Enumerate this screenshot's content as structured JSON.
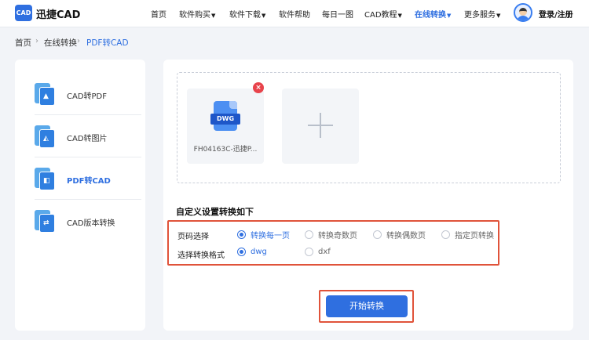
{
  "header": {
    "logo_text": "CAD",
    "brand": "迅捷CAD",
    "nav": [
      {
        "label": "首页",
        "dropdown": false,
        "active": false
      },
      {
        "label": "软件购买",
        "dropdown": true,
        "active": false
      },
      {
        "label": "软件下载",
        "dropdown": true,
        "active": false
      },
      {
        "label": "软件帮助",
        "dropdown": false,
        "active": false
      },
      {
        "label": "每日一图",
        "dropdown": false,
        "active": false
      },
      {
        "label": "CAD教程",
        "dropdown": true,
        "active": false
      },
      {
        "label": "在线转换",
        "dropdown": true,
        "active": true
      },
      {
        "label": "更多服务",
        "dropdown": true,
        "active": false
      }
    ],
    "login": "登录/注册"
  },
  "breadcrumb": [
    "首页",
    "在线转换",
    "PDF转CAD"
  ],
  "sidebar": {
    "items": [
      {
        "label": "CAD转PDF",
        "icon": "cad-to-pdf-icon",
        "active": false
      },
      {
        "label": "CAD转图片",
        "icon": "cad-to-image-icon",
        "active": false
      },
      {
        "label": "PDF转CAD",
        "icon": "pdf-to-cad-icon",
        "active": true
      },
      {
        "label": "CAD版本转换",
        "icon": "cad-version-icon",
        "active": false
      }
    ]
  },
  "upload": {
    "file": {
      "type_tag": "DWG",
      "name": "FH04163C-迅捷P..."
    },
    "remove_symbol": "×"
  },
  "settings": {
    "title": "自定义设置转换如下",
    "page_label": "页码选择",
    "page_options": [
      {
        "label": "转换每一页",
        "selected": true
      },
      {
        "label": "转换奇数页",
        "selected": false
      },
      {
        "label": "转换偶数页",
        "selected": false
      },
      {
        "label": "指定页转换",
        "selected": false
      }
    ],
    "format_label": "选择转换格式",
    "format_options": [
      {
        "label": "dwg",
        "selected": true
      },
      {
        "label": "dxf",
        "selected": false
      }
    ]
  },
  "actions": {
    "start": "开始转换"
  },
  "colors": {
    "accent": "#2f6fe0",
    "highlight_border": "#e0533a",
    "remove": "#e8434b"
  }
}
